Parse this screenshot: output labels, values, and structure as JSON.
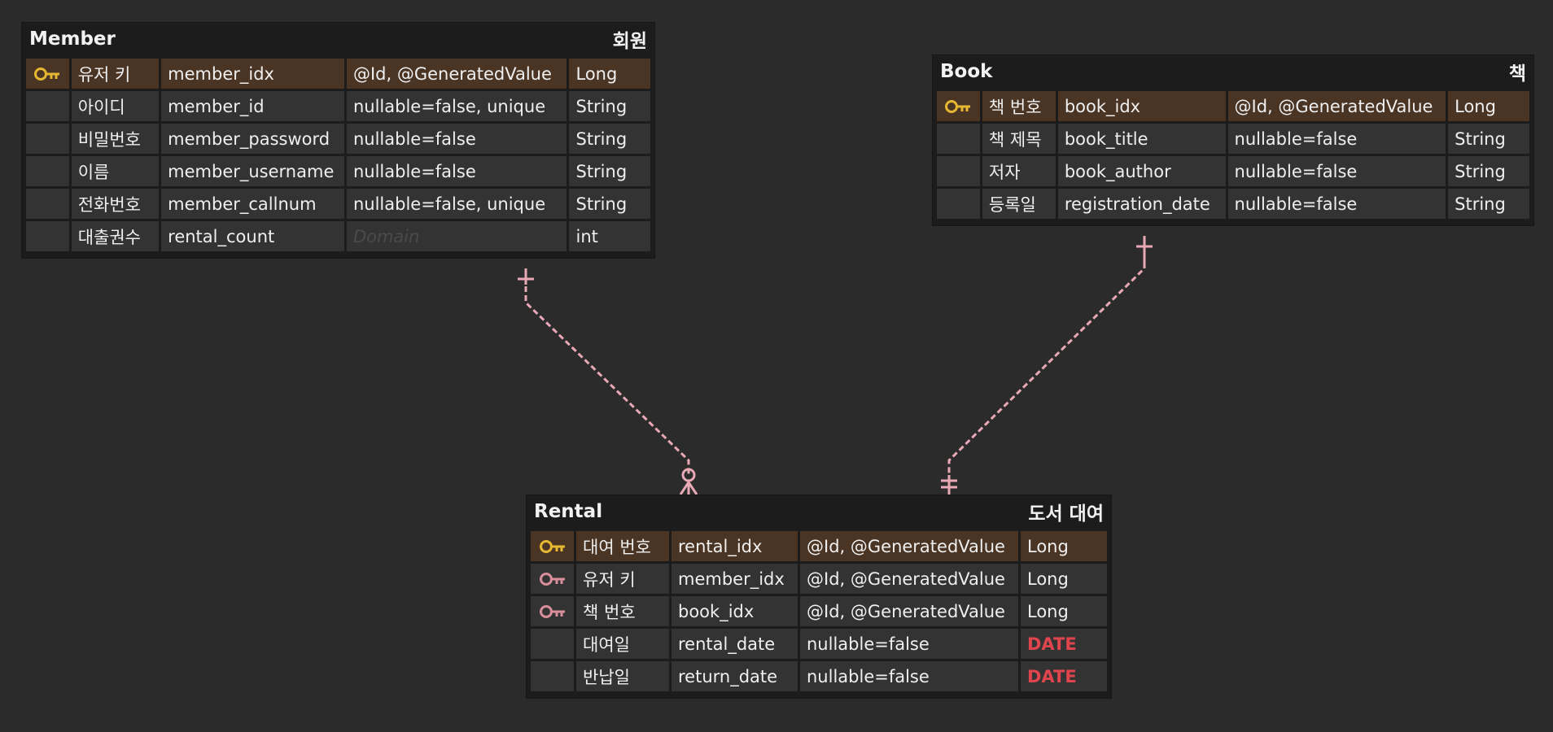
{
  "colors": {
    "background": "#2b2b2b",
    "pk_row": "#4a3424",
    "pk_key": "#e6b832",
    "fk_key": "#d98e9b",
    "relationship": "#e9a8b5",
    "date_type": "#e0454e"
  },
  "entities": {
    "member": {
      "name": "Member",
      "logical_name": "회원",
      "columns": [
        {
          "key": "pk",
          "logical": "유저 키",
          "physical": "member_idx",
          "options": "@Id, @GeneratedValue",
          "type": "Long"
        },
        {
          "key": "",
          "logical": "아이디",
          "physical": "member_id",
          "options": "nullable=false, unique",
          "type": "String"
        },
        {
          "key": "",
          "logical": "비밀번호",
          "physical": "member_password",
          "options": "nullable=false",
          "type": "String"
        },
        {
          "key": "",
          "logical": "이름",
          "physical": "member_username",
          "options": "nullable=false",
          "type": "String"
        },
        {
          "key": "",
          "logical": "전화번호",
          "physical": "member_callnum",
          "options": "nullable=false, unique",
          "type": "String"
        },
        {
          "key": "",
          "logical": "대출권수",
          "physical": "rental_count",
          "options": "",
          "options_placeholder": "Domain",
          "type": "int"
        }
      ]
    },
    "book": {
      "name": "Book",
      "logical_name": "책",
      "columns": [
        {
          "key": "pk",
          "logical": "책 번호",
          "physical": "book_idx",
          "options": "@Id, @GeneratedValue",
          "type": "Long"
        },
        {
          "key": "",
          "logical": "책 제목",
          "physical": "book_title",
          "options": "nullable=false",
          "type": "String"
        },
        {
          "key": "",
          "logical": "저자",
          "physical": "book_author",
          "options": "nullable=false",
          "type": "String"
        },
        {
          "key": "",
          "logical": "등록일",
          "physical": "registration_date",
          "options": "nullable=false",
          "type": "String"
        }
      ]
    },
    "rental": {
      "name": "Rental",
      "logical_name": "도서 대여",
      "columns": [
        {
          "key": "pk",
          "logical": "대여 번호",
          "physical": "rental_idx",
          "options": "@Id, @GeneratedValue",
          "type": "Long"
        },
        {
          "key": "fk",
          "logical": "유저 키",
          "physical": "member_idx",
          "options": "@Id, @GeneratedValue",
          "type": "Long"
        },
        {
          "key": "fk",
          "logical": "책 번호",
          "physical": "book_idx",
          "options": "@Id, @GeneratedValue",
          "type": "Long"
        },
        {
          "key": "",
          "logical": "대여일",
          "physical": "rental_date",
          "options": "nullable=false",
          "type": "DATE"
        },
        {
          "key": "",
          "logical": "반납일",
          "physical": "return_date",
          "options": "nullable=false",
          "type": "DATE"
        }
      ]
    }
  },
  "relationships": [
    {
      "from": "member",
      "to": "rental",
      "from_cardinality": "one",
      "to_cardinality": "zero-or-many",
      "style": "dashed"
    },
    {
      "from": "book",
      "to": "rental",
      "from_cardinality": "one",
      "to_cardinality": "one-and-only-one",
      "style": "dashed"
    }
  ]
}
